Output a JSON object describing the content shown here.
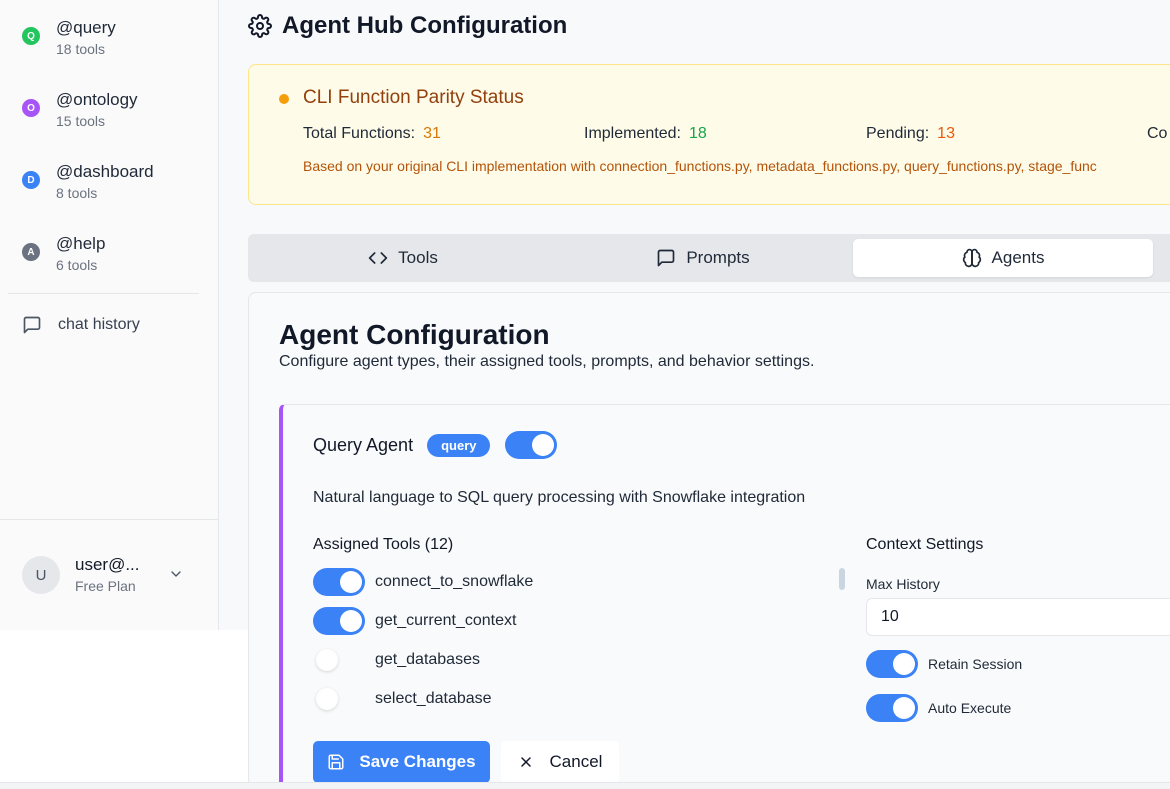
{
  "sidebar": {
    "agents": [
      {
        "letter": "Q",
        "name": "@query",
        "count": "18 tools",
        "color": "#22c55e"
      },
      {
        "letter": "O",
        "name": "@ontology",
        "count": "15 tools",
        "color": "#a855f7"
      },
      {
        "letter": "D",
        "name": "@dashboard",
        "count": "8 tools",
        "color": "#3b82f6"
      },
      {
        "letter": "A",
        "name": "@help",
        "count": "6 tools",
        "color": "#6b7280"
      }
    ],
    "chat_history": "chat history",
    "user": {
      "avatar": "U",
      "name": "user@...",
      "plan": "Free Plan"
    }
  },
  "header": {
    "title": "Agent Hub Configuration",
    "icon": "gear-icon"
  },
  "parity": {
    "title": "CLI Function Parity Status",
    "total_label": "Total Functions:",
    "total_value": "31",
    "implemented_label": "Implemented:",
    "implemented_value": "18",
    "pending_label": "Pending:",
    "pending_value": "13",
    "coverage_label": "Co",
    "note": "Based on your original CLI implementation with connection_functions.py, metadata_functions.py, query_functions.py, stage_func",
    "colors": {
      "total": "#d97706",
      "implemented": "#16a34a",
      "pending": "#ea580c"
    }
  },
  "tabs": [
    {
      "label": "Tools",
      "icon": "code-icon"
    },
    {
      "label": "Prompts",
      "icon": "message-square-icon"
    },
    {
      "label": "Agents",
      "icon": "brain-icon",
      "active": true
    }
  ],
  "panel": {
    "title": "Agent Configuration",
    "subtitle": "Configure agent types, their assigned tools, prompts, and behavior settings."
  },
  "agent_card": {
    "name": "Query Agent",
    "badge": "query",
    "enabled": true,
    "description": "Natural language to SQL query processing with Snowflake integration",
    "tools_title": "Assigned Tools (12)",
    "tools": [
      {
        "name": "connect_to_snowflake",
        "enabled": true
      },
      {
        "name": "get_current_context",
        "enabled": true
      },
      {
        "name": "get_databases",
        "enabled": false
      },
      {
        "name": "select_database",
        "enabled": false
      }
    ],
    "context": {
      "title": "Context Settings",
      "max_history_label": "Max History",
      "max_history_value": "10",
      "retain_session_label": "Retain Session",
      "retain_session": true,
      "auto_execute_label": "Auto Execute",
      "auto_execute": true
    },
    "save_label": "Save Changes",
    "cancel_label": "Cancel"
  }
}
